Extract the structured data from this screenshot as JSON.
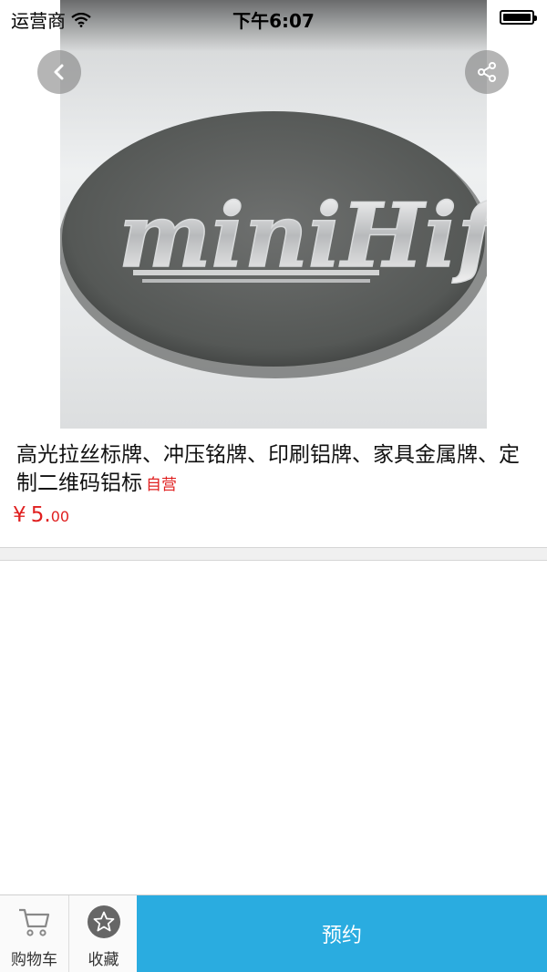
{
  "status_bar": {
    "carrier": "运营商",
    "time": "下午6:07"
  },
  "product": {
    "title": "高光拉丝标牌、冲压铭牌、印刷铝牌、家具金属牌、定制二维码铝标",
    "badge": "自营",
    "currency": "¥",
    "price_integer": "5.",
    "price_decimal": "00",
    "image_text": "miniHifi"
  },
  "bottom_bar": {
    "cart_label": "购物车",
    "favorite_label": "收藏",
    "book_label": "预约"
  },
  "colors": {
    "accent": "#2aace0",
    "price": "#e02020"
  },
  "icons": {
    "back": "chevron-left-icon",
    "share": "share-icon",
    "cart": "cart-icon",
    "favorite": "star-icon",
    "wifi": "wifi-icon",
    "battery": "battery-icon"
  }
}
